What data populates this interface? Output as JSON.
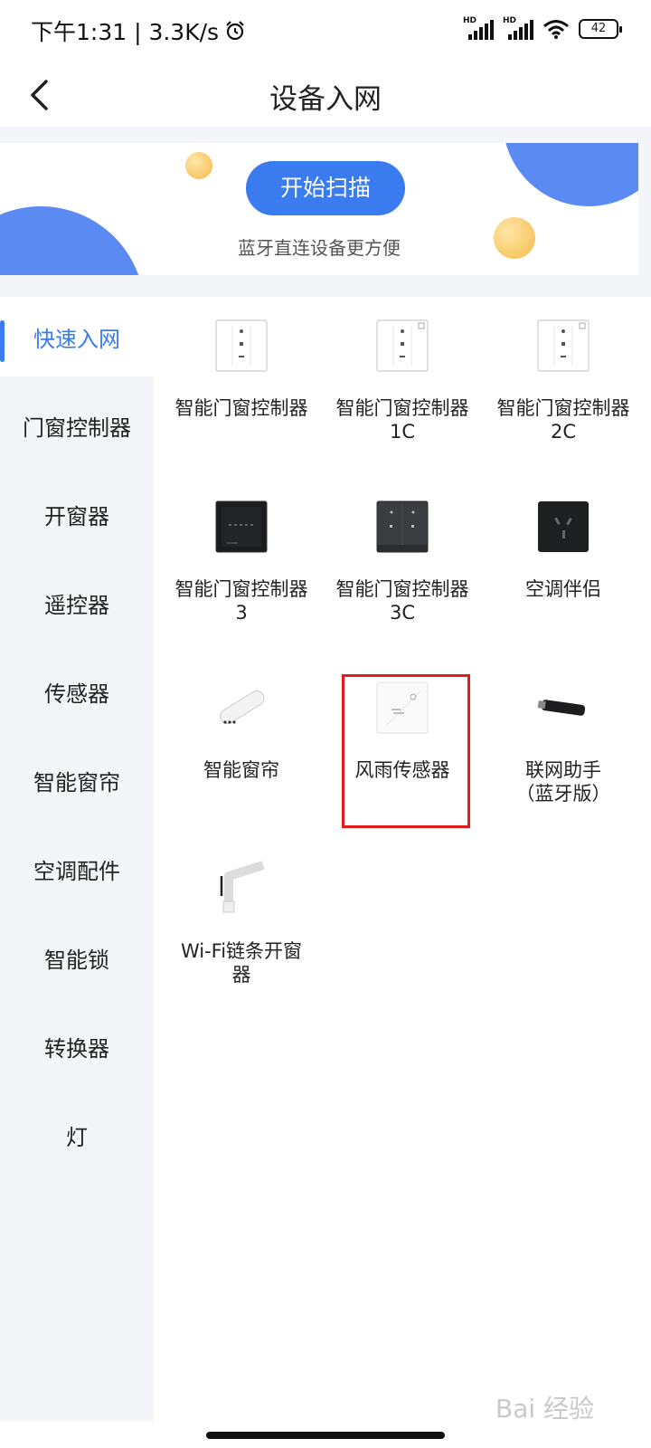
{
  "status_bar": {
    "time_speed": "下午1:31 | 3.3K/s",
    "alarm_icon": "alarm-icon",
    "signal_label_1": "HD",
    "signal_label_2": "HD",
    "battery": "42"
  },
  "nav": {
    "back_icon": "chevron-left-icon",
    "title": "设备入网"
  },
  "banner": {
    "scan_button": "开始扫描",
    "subtitle": "蓝牙直连设备更方便",
    "accent_color": "#3a7bf0"
  },
  "sidebar": {
    "items": [
      {
        "label": "快速入网",
        "active": true
      },
      {
        "label": "门窗控制器"
      },
      {
        "label": "开窗器"
      },
      {
        "label": "遥控器"
      },
      {
        "label": "传感器"
      },
      {
        "label": "智能窗帘"
      },
      {
        "label": "空调配件"
      },
      {
        "label": "智能锁"
      },
      {
        "label": "转换器"
      },
      {
        "label": "灯"
      }
    ]
  },
  "devices": [
    {
      "label": "智能门窗控制器",
      "icon": "white-switch-panel-icon"
    },
    {
      "label": "智能门窗控制器\n1C",
      "icon": "white-switch-panel-1c-icon"
    },
    {
      "label": "智能门窗控制器\n2C",
      "icon": "white-switch-panel-2c-icon"
    },
    {
      "label": "智能门窗控制器\n3",
      "icon": "black-screen-panel-icon"
    },
    {
      "label": "智能门窗控制器\n3C",
      "icon": "gray-switch-panel-icon"
    },
    {
      "label": "空调伴侣",
      "icon": "ac-socket-icon"
    },
    {
      "label": "智能窗帘",
      "icon": "curtain-motor-icon"
    },
    {
      "label": "风雨传感器",
      "icon": "wind-rain-sensor-icon",
      "highlighted": true
    },
    {
      "label": "联网助手\n（蓝牙版）",
      "icon": "usb-dongle-icon"
    },
    {
      "label": "Wi-Fi链条开窗\n器",
      "icon": "chain-window-opener-icon"
    }
  ],
  "highlight_color": "#e21b1b",
  "watermark": "Bai 经验"
}
